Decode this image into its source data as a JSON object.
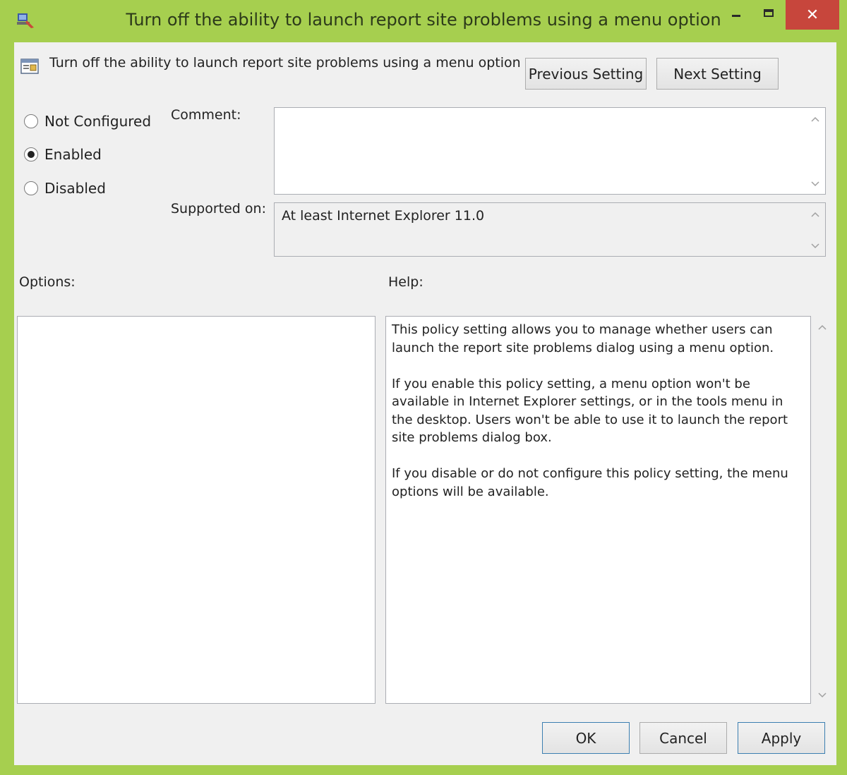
{
  "window": {
    "title": "Turn off the ability to launch report site problems using a menu option",
    "accent_color": "#a6cf4f",
    "close_color": "#c7463c",
    "controls": {
      "minimize": "–",
      "close": "✕"
    }
  },
  "setting": {
    "name": "Turn off the ability to launch report site problems using a menu option",
    "previous_label": "Previous Setting",
    "next_label": "Next Setting"
  },
  "state": {
    "options": [
      {
        "label": "Not Configured",
        "selected": false
      },
      {
        "label": "Enabled",
        "selected": true
      },
      {
        "label": "Disabled",
        "selected": false
      }
    ]
  },
  "comment": {
    "label": "Comment:",
    "value": ""
  },
  "supported": {
    "label": "Supported on:",
    "value": "At least Internet Explorer 11.0"
  },
  "options_panel": {
    "label": "Options:"
  },
  "help_panel": {
    "label": "Help:",
    "paragraphs": [
      "This policy setting allows you to manage whether users can launch the report site problems dialog using a menu option.",
      "If you enable this policy setting, a menu option won't be available in Internet Explorer settings, or in the tools menu in the desktop. Users won't be able to use it to launch the report site problems dialog box.",
      "If you disable or do not configure this policy setting, the menu options will be available."
    ]
  },
  "footer": {
    "ok_label": "OK",
    "cancel_label": "Cancel",
    "apply_label": "Apply"
  },
  "icons": {
    "app": "group-policy-icon",
    "setting": "policy-setting-icon",
    "scroll_up": "chevron-up-icon",
    "scroll_down": "chevron-down-icon"
  }
}
